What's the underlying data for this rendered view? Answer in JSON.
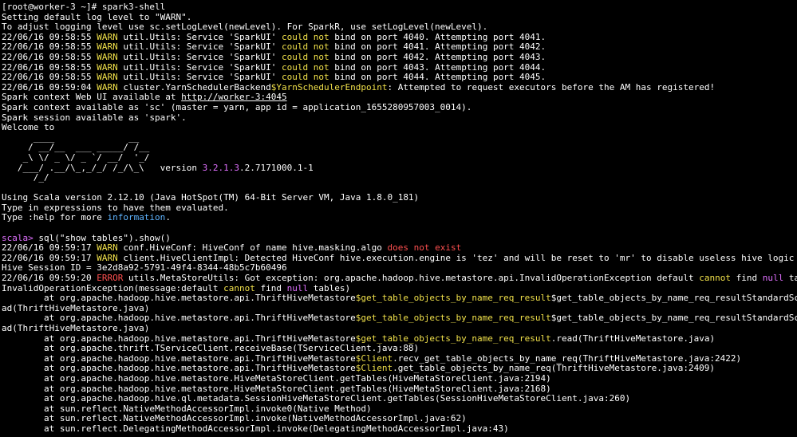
{
  "terminal": {
    "lines": [
      [
        {
          "t": "[root@worker-3 ~]# spark3-shell"
        }
      ],
      [
        {
          "t": "Setting default log level to \"WARN\"."
        }
      ],
      [
        {
          "t": "To adjust logging level use sc.setLogLevel(newLevel). For SparkR, use setLogLevel(newLevel)."
        }
      ],
      [
        {
          "t": "22/06/16 09:58:55 "
        },
        {
          "t": "WARN",
          "c": "y"
        },
        {
          "t": " util.Utils: Service 'SparkUI' "
        },
        {
          "t": "could not",
          "c": "y"
        },
        {
          "t": " bind on port 4040. Attempting port 4041."
        }
      ],
      [
        {
          "t": "22/06/16 09:58:55 "
        },
        {
          "t": "WARN",
          "c": "y"
        },
        {
          "t": " util.Utils: Service 'SparkUI' "
        },
        {
          "t": "could not",
          "c": "y"
        },
        {
          "t": " bind on port 4041. Attempting port 4042."
        }
      ],
      [
        {
          "t": "22/06/16 09:58:55 "
        },
        {
          "t": "WARN",
          "c": "y"
        },
        {
          "t": " util.Utils: Service 'SparkUI' "
        },
        {
          "t": "could not",
          "c": "y"
        },
        {
          "t": " bind on port 4042. Attempting port 4043."
        }
      ],
      [
        {
          "t": "22/06/16 09:58:55 "
        },
        {
          "t": "WARN",
          "c": "y"
        },
        {
          "t": " util.Utils: Service 'SparkUI' "
        },
        {
          "t": "could not",
          "c": "y"
        },
        {
          "t": " bind on port 4043. Attempting port 4044."
        }
      ],
      [
        {
          "t": "22/06/16 09:58:55 "
        },
        {
          "t": "WARN",
          "c": "y"
        },
        {
          "t": " util.Utils: Service 'SparkUI' "
        },
        {
          "t": "could not",
          "c": "y"
        },
        {
          "t": " bind on port 4044. Attempting port 4045."
        }
      ],
      [
        {
          "t": "22/06/16 09:59:04 "
        },
        {
          "t": "WARN",
          "c": "y"
        },
        {
          "t": " cluster.YarnSchedulerBackend"
        },
        {
          "t": "$YarnSchedulerEndpoint",
          "c": "y"
        },
        {
          "t": ": Attempted to request executors before the AM has registered!"
        }
      ],
      [
        {
          "t": "Spark context Web UI available at "
        },
        {
          "t": "http://worker-3:4045",
          "c": "u"
        }
      ],
      [
        {
          "t": "Spark context available as 'sc' (master = yarn, app id = application_1655280957003_0014)."
        }
      ],
      [
        {
          "t": "Spark session available as 'spark'."
        }
      ],
      [
        {
          "t": "Welcome to"
        }
      ],
      [
        {
          "t": "      ____              __"
        }
      ],
      [
        {
          "t": "     / __/__  ___ _____/ /__"
        }
      ],
      [
        {
          "t": "    _\\ \\/ _ \\/ _ `/ __/  '_/"
        }
      ],
      [
        {
          "t": "   /___/ .__/\\_,_/_/ /_/\\_\\   version "
        },
        {
          "t": "3.2.1.3",
          "c": "m"
        },
        {
          "t": ".2.7171000.1-1"
        }
      ],
      [
        {
          "t": "      /_/"
        }
      ],
      [
        {
          "t": ""
        }
      ],
      [
        {
          "t": "Using Scala version 2.12.10 (Java HotSpot(TM) 64-Bit Server VM, Java 1.8.0_181)"
        }
      ],
      [
        {
          "t": "Type in expressions to have them evaluated."
        }
      ],
      [
        {
          "t": "Type :help for more "
        },
        {
          "t": "information",
          "c": "c"
        },
        {
          "t": "."
        }
      ],
      [
        {
          "t": ""
        }
      ],
      [
        {
          "t": "scala> ",
          "c": "m"
        },
        {
          "t": "sql(\"show tables\").show()"
        }
      ],
      [
        {
          "t": "22/06/16 09:59:17 "
        },
        {
          "t": "WARN",
          "c": "y"
        },
        {
          "t": " conf.HiveConf: HiveConf of name hive.masking.algo "
        },
        {
          "t": "does not exist",
          "c": "r"
        }
      ],
      [
        {
          "t": "22/06/16 09:59:17 "
        },
        {
          "t": "WARN",
          "c": "y"
        },
        {
          "t": " client.HiveClientImpl: Detected HiveConf hive.execution.engine is 'tez' and will be reset to 'mr' to disable useless hive logic"
        }
      ],
      [
        {
          "t": "Hive Session ID = 3e2d8a92-5791-49f4-8344-48b5c7b60496"
        }
      ],
      [
        {
          "t": "22/06/16 09:59:20 "
        },
        {
          "t": "ERROR",
          "c": "r"
        },
        {
          "t": " utils.MetaStoreUtils: Got exception: org.apache.hadoop.hive.metastore.api.InvalidOperationException default "
        },
        {
          "t": "cannot",
          "c": "y"
        },
        {
          "t": " find "
        },
        {
          "t": "null",
          "c": "m"
        },
        {
          "t": " tables"
        }
      ],
      [
        {
          "t": "InvalidOperationException(message:default "
        },
        {
          "t": "cannot",
          "c": "y"
        },
        {
          "t": " find "
        },
        {
          "t": "null",
          "c": "m"
        },
        {
          "t": " tables)"
        }
      ],
      [
        {
          "t": "        at org.apache.hadoop.hive.metastore.api.ThriftHiveMetastore"
        },
        {
          "t": "$get_table_objects_by_name_req_result",
          "c": "y"
        },
        {
          "t": "$get_table_objects_by_name_req_resultStandardScheme.re"
        }
      ],
      [
        {
          "t": "ad(ThriftHiveMetastore.java)"
        }
      ],
      [
        {
          "t": "        at org.apache.hadoop.hive.metastore.api.ThriftHiveMetastore"
        },
        {
          "t": "$get_table_objects_by_name_req_result",
          "c": "y"
        },
        {
          "t": "$get_table_objects_by_name_req_resultStandardScheme.re"
        }
      ],
      [
        {
          "t": "ad(ThriftHiveMetastore.java)"
        }
      ],
      [
        {
          "t": "        at org.apache.hadoop.hive.metastore.api.ThriftHiveMetastore"
        },
        {
          "t": "$get_table_objects_by_name_req_result",
          "c": "y"
        },
        {
          "t": ".read(ThriftHiveMetastore.java)"
        }
      ],
      [
        {
          "t": "        at org.apache.thrift.TServiceClient.receiveBase(TServiceClient.java:88)"
        }
      ],
      [
        {
          "t": "        at org.apache.hadoop.hive.metastore.api.ThriftHiveMetastore"
        },
        {
          "t": "$Client",
          "c": "y"
        },
        {
          "t": ".recv_get_table_objects_by_name_req(ThriftHiveMetastore.java:2422)"
        }
      ],
      [
        {
          "t": "        at org.apache.hadoop.hive.metastore.api.ThriftHiveMetastore"
        },
        {
          "t": "$Client",
          "c": "y"
        },
        {
          "t": ".get_table_objects_by_name_req(ThriftHiveMetastore.java:2409)"
        }
      ],
      [
        {
          "t": "        at org.apache.hadoop.hive.metastore.HiveMetaStoreClient.getTables(HiveMetaStoreClient.java:2194)"
        }
      ],
      [
        {
          "t": "        at org.apache.hadoop.hive.metastore.HiveMetaStoreClient.getTables(HiveMetaStoreClient.java:2168)"
        }
      ],
      [
        {
          "t": "        at org.apache.hadoop.hive.ql.metadata.SessionHiveMetaStoreClient.getTables(SessionHiveMetaStoreClient.java:260)"
        }
      ],
      [
        {
          "t": "        at sun.reflect.NativeMethodAccessorImpl.invoke0(Native Method)"
        }
      ],
      [
        {
          "t": "        at sun.reflect.NativeMethodAccessorImpl.invoke(NativeMethodAccessorImpl.java:62)"
        }
      ],
      [
        {
          "t": "        at sun.reflect.DelegatingMethodAccessorImpl.invoke(DelegatingMethodAccessorImpl.java:43)"
        }
      ]
    ]
  },
  "colors": {
    "background": "#000000",
    "text": "#ffffff",
    "warn_yellow": "#f0e04a",
    "error_red": "#ff5050",
    "magenta": "#e070ff",
    "cyan": "#5fb4ff"
  }
}
